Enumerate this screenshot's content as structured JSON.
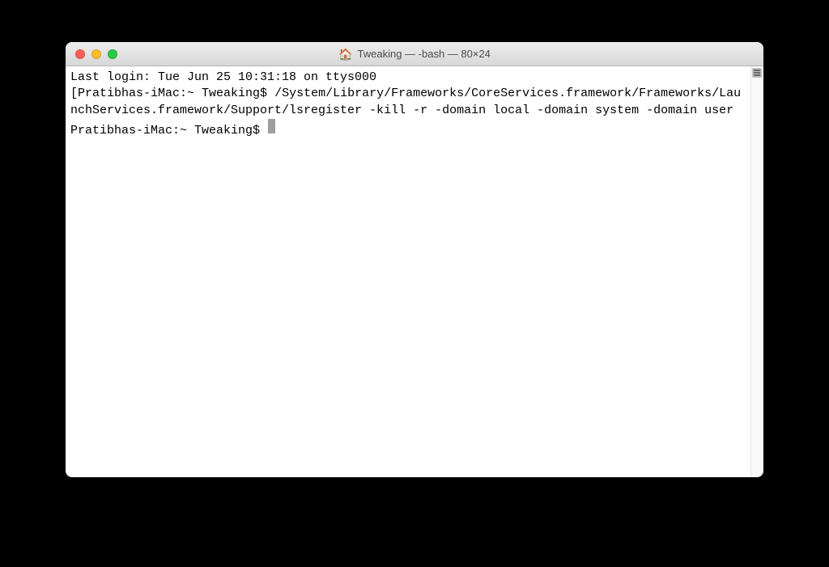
{
  "window": {
    "title": "Tweaking — -bash — 80×24",
    "home_icon": "🏠"
  },
  "terminal": {
    "last_login": "Last login: Tue Jun 25 10:31:18 on ttys000",
    "line_bracket_open": "[",
    "prompt1": "Pratibhas-iMac:~ Tweaking$ ",
    "command_wrapped": "/System/Library/Frameworks/CoreServices.framework/Frameworks/LaunchServices.framework/Support/lsregister -kill -r -domain local -domain system -domain user",
    "line_bracket_close": "]",
    "prompt2": "Pratibhas-iMac:~ Tweaking$ "
  }
}
